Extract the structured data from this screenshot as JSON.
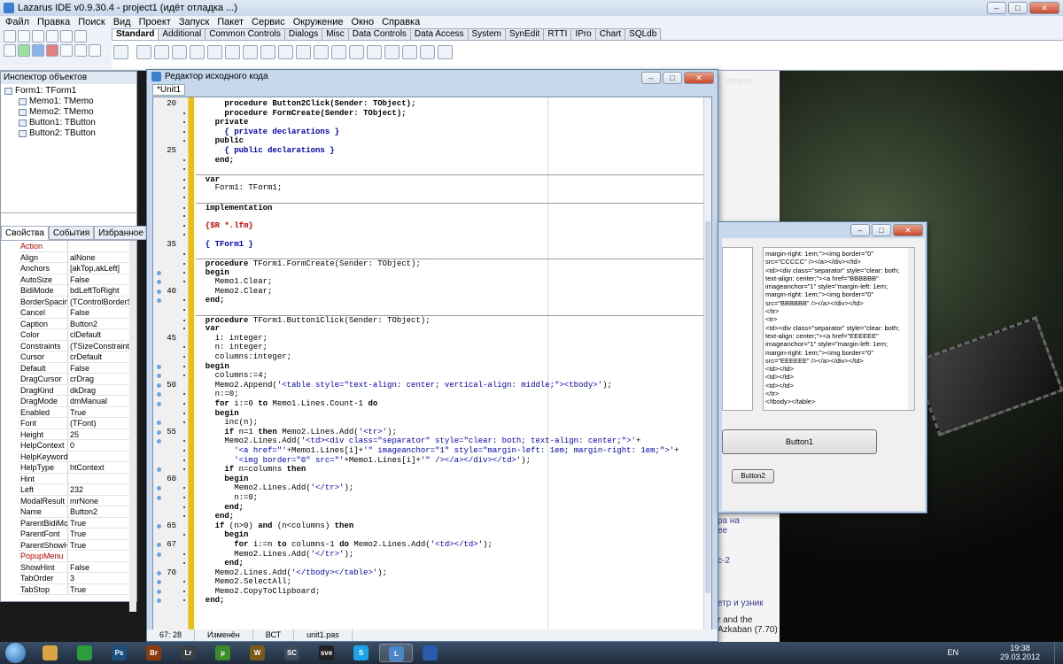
{
  "ide": {
    "title": "Lazarus IDE v0.9.30.4 - project1 (идёт отладка ...)",
    "menu": [
      "Файл",
      "Правка",
      "Поиск",
      "Вид",
      "Проект",
      "Запуск",
      "Пакет",
      "Сервис",
      "Окружение",
      "Окно",
      "Справка"
    ],
    "palette_tabs": [
      "Standard",
      "Additional",
      "Common Controls",
      "Dialogs",
      "Misc",
      "Data Controls",
      "Data Access",
      "System",
      "SynEdit",
      "RTTI",
      "IPro",
      "Chart",
      "SQLdb"
    ],
    "active_palette_tab": "Standard"
  },
  "inspector": {
    "title": "Инспектор объектов",
    "tree": [
      {
        "label": "Form1: TForm1",
        "child": false
      },
      {
        "label": "Memo1: TMemo",
        "child": true
      },
      {
        "label": "Memo2: TMemo",
        "child": true
      },
      {
        "label": "Button1: TButton",
        "child": true
      },
      {
        "label": "Button2: TButton",
        "child": true
      }
    ],
    "tabs": [
      "Свойства",
      "События",
      "Избранное"
    ],
    "props": [
      {
        "n": "Action",
        "v": "",
        "section": true
      },
      {
        "n": "Align",
        "v": "alNone"
      },
      {
        "n": "Anchors",
        "v": "[akTop,akLeft]"
      },
      {
        "n": "AutoSize",
        "v": "False"
      },
      {
        "n": "BidiMode",
        "v": "bdLeftToRight"
      },
      {
        "n": "BorderSpacing",
        "v": "(TControlBorderS"
      },
      {
        "n": "Cancel",
        "v": "False"
      },
      {
        "n": "Caption",
        "v": "Button2"
      },
      {
        "n": "Color",
        "v": "clDefault"
      },
      {
        "n": "Constraints",
        "v": "(TSizeConstraints"
      },
      {
        "n": "Cursor",
        "v": "crDefault"
      },
      {
        "n": "Default",
        "v": "False"
      },
      {
        "n": "DragCursor",
        "v": "crDrag"
      },
      {
        "n": "DragKind",
        "v": "dkDrag"
      },
      {
        "n": "DragMode",
        "v": "dmManual"
      },
      {
        "n": "Enabled",
        "v": "True"
      },
      {
        "n": "Font",
        "v": "(TFont)"
      },
      {
        "n": "Height",
        "v": "25"
      },
      {
        "n": "HelpContext",
        "v": "0"
      },
      {
        "n": "HelpKeyword",
        "v": ""
      },
      {
        "n": "HelpType",
        "v": "htContext"
      },
      {
        "n": "Hint",
        "v": ""
      },
      {
        "n": "Left",
        "v": "232"
      },
      {
        "n": "ModalResult",
        "v": "mrNone"
      },
      {
        "n": "Name",
        "v": "Button2"
      },
      {
        "n": "ParentBidiMode",
        "v": "True"
      },
      {
        "n": "ParentFont",
        "v": "True"
      },
      {
        "n": "ParentShowHint",
        "v": "True"
      },
      {
        "n": "PopupMenu",
        "v": "",
        "section": true
      },
      {
        "n": "ShowHint",
        "v": "False"
      },
      {
        "n": "TabOrder",
        "v": "3"
      },
      {
        "n": "TabStop",
        "v": "True"
      }
    ]
  },
  "editor": {
    "title": "Редактор исходного кода",
    "tab": "*Unit1",
    "status": [
      "67: 28",
      "Изменён",
      "ВСТ",
      "unit1.pas"
    ],
    "lines": [
      {
        "ln": "20",
        "segs": [
          [
            "      procedure Button2Click(Sender: TObject);",
            "kw"
          ]
        ]
      },
      {
        "segs": [
          [
            "      procedure FormCreate(Sender: TObject);",
            "kw"
          ]
        ]
      },
      {
        "segs": [
          [
            "    private",
            "kw"
          ]
        ]
      },
      {
        "segs": [
          [
            "      { private declarations }",
            "cm"
          ]
        ]
      },
      {
        "segs": [
          [
            "    public",
            "kw"
          ]
        ]
      },
      {
        "ln": "25",
        "segs": [
          [
            "      { public declarations }",
            "cm"
          ]
        ]
      },
      {
        "segs": [
          [
            "    end;",
            "kw"
          ]
        ]
      },
      {
        "segs": [
          [
            "",
            ""
          ]
        ]
      },
      {
        "segs": [
          [
            "  var",
            "kw"
          ]
        ],
        "sep": true
      },
      {
        "segs": [
          [
            "    Form1: TForm1;",
            ""
          ]
        ]
      },
      {
        "segs": [
          [
            "",
            ""
          ]
        ]
      },
      {
        "segs": [
          [
            "  implementation",
            "kw"
          ]
        ],
        "sep": true
      },
      {
        "segs": [
          [
            "",
            ""
          ]
        ]
      },
      {
        "segs": [
          [
            "  {$R *.lfm}",
            "dir"
          ]
        ]
      },
      {
        "segs": [
          [
            "",
            ""
          ]
        ]
      },
      {
        "ln": "35",
        "segs": [
          [
            "  { TForm1 }",
            "cm"
          ]
        ]
      },
      {
        "segs": [
          [
            "",
            ""
          ]
        ]
      },
      {
        "segs": [
          [
            "  procedure",
            "kw"
          ],
          [
            " TForm1.FormCreate(Sender: TObject);",
            ""
          ]
        ],
        "sep": true
      },
      {
        "bp": true,
        "segs": [
          [
            "  begin",
            "kw"
          ]
        ]
      },
      {
        "bp": true,
        "segs": [
          [
            "    Memo1.Clear;",
            ""
          ]
        ]
      },
      {
        "ln": "40",
        "bp": true,
        "segs": [
          [
            "    Memo2.Clear;",
            ""
          ]
        ]
      },
      {
        "bp": true,
        "segs": [
          [
            "  end;",
            "kw"
          ]
        ]
      },
      {
        "segs": [
          [
            "",
            ""
          ]
        ]
      },
      {
        "segs": [
          [
            "  procedure",
            "kw"
          ],
          [
            " TForm1.Button1Click(Sender: TObject);",
            ""
          ]
        ],
        "sep": true
      },
      {
        "segs": [
          [
            "  var",
            "kw"
          ]
        ]
      },
      {
        "ln": "45",
        "segs": [
          [
            "    i: integer;",
            ""
          ]
        ]
      },
      {
        "segs": [
          [
            "    n: integer;",
            ""
          ]
        ]
      },
      {
        "segs": [
          [
            "    columns:integer;",
            ""
          ]
        ]
      },
      {
        "bp": true,
        "segs": [
          [
            "  begin",
            "kw"
          ]
        ]
      },
      {
        "bp": true,
        "segs": [
          [
            "    columns:=4;",
            ""
          ]
        ]
      },
      {
        "ln": "50",
        "bp": true,
        "segs": [
          [
            "    Memo2.Append(",
            ""
          ],
          [
            "'<table style=\"text-align: center; vertical-align: middle;\"><tbody>'",
            "str"
          ],
          [
            ");",
            ""
          ]
        ]
      },
      {
        "bp": true,
        "segs": [
          [
            "    n:=0;",
            ""
          ]
        ]
      },
      {
        "bp": true,
        "segs": [
          [
            "    for",
            "kw"
          ],
          [
            " i:=0 ",
            ""
          ],
          [
            "to",
            "kw"
          ],
          [
            " Memo1.Lines.Count-1 ",
            ""
          ],
          [
            "do",
            "kw"
          ]
        ]
      },
      {
        "segs": [
          [
            "    begin",
            "kw"
          ]
        ]
      },
      {
        "bp": true,
        "segs": [
          [
            "      inc(n);",
            ""
          ]
        ]
      },
      {
        "ln": "55",
        "bp": true,
        "segs": [
          [
            "      if",
            "kw"
          ],
          [
            " n=1 ",
            ""
          ],
          [
            "then",
            "kw"
          ],
          [
            " Memo2.Lines.Add(",
            ""
          ],
          [
            "'<tr>'",
            "str"
          ],
          [
            ");",
            ""
          ]
        ]
      },
      {
        "bp": true,
        "segs": [
          [
            "      Memo2.Lines.Add(",
            ""
          ],
          [
            "'<td><div class=\"separator\" style=\"clear: both; text-align: center;\">'",
            "str"
          ],
          [
            "+",
            ""
          ]
        ]
      },
      {
        "segs": [
          [
            "        ",
            ""
          ],
          [
            "'<a href=\"'",
            "str"
          ],
          [
            "+Memo1.Lines[i]+",
            ""
          ],
          [
            "'\" imageanchor=\"1\" style=\"margin-left: 1em; margin-right: 1em;\">'",
            "str"
          ],
          [
            "+",
            ""
          ]
        ]
      },
      {
        "segs": [
          [
            "        ",
            ""
          ],
          [
            "'<img border=\"0\" src=\"'",
            "str"
          ],
          [
            "+Memo1.Lines[i]+",
            ""
          ],
          [
            "'\" /></a></div></td>'",
            "str"
          ],
          [
            ");",
            ""
          ]
        ]
      },
      {
        "bp": true,
        "segs": [
          [
            "      if",
            "kw"
          ],
          [
            " n=columns ",
            ""
          ],
          [
            "then",
            "kw"
          ]
        ]
      },
      {
        "ln": "60",
        "segs": [
          [
            "      begin",
            "kw"
          ]
        ]
      },
      {
        "bp": true,
        "segs": [
          [
            "        Memo2.Lines.Add(",
            ""
          ],
          [
            "'</tr>'",
            "str"
          ],
          [
            ");",
            ""
          ]
        ]
      },
      {
        "bp": true,
        "segs": [
          [
            "        n:=0;",
            ""
          ]
        ]
      },
      {
        "segs": [
          [
            "      end;",
            "kw"
          ]
        ]
      },
      {
        "segs": [
          [
            "    end;",
            "kw"
          ]
        ]
      },
      {
        "ln": "65",
        "bp": true,
        "segs": [
          [
            "    if",
            "kw"
          ],
          [
            " (n>0) ",
            ""
          ],
          [
            "and",
            "kw"
          ],
          [
            " (n<columns) ",
            ""
          ],
          [
            "then",
            "kw"
          ]
        ]
      },
      {
        "segs": [
          [
            "      begin",
            "kw"
          ]
        ]
      },
      {
        "ln": "67",
        "bp": true,
        "segs": [
          [
            "        for",
            "kw"
          ],
          [
            " i:=n ",
            ""
          ],
          [
            "to",
            "kw"
          ],
          [
            " columns-1 ",
            ""
          ],
          [
            "do",
            "kw"
          ],
          [
            " Memo2.Lines.Add(",
            ""
          ],
          [
            "'<td></td>'",
            "str"
          ],
          [
            ");",
            ""
          ]
        ]
      },
      {
        "bp": true,
        "segs": [
          [
            "        Memo2.Lines.Add(",
            ""
          ],
          [
            "'</tr>'",
            "str"
          ],
          [
            ");",
            ""
          ]
        ]
      },
      {
        "segs": [
          [
            "      end;",
            "kw"
          ]
        ]
      },
      {
        "ln": "70",
        "bp": true,
        "segs": [
          [
            "    Memo2.Lines.Add(",
            ""
          ],
          [
            "'</tbody></table>'",
            "str"
          ],
          [
            ");",
            ""
          ]
        ]
      },
      {
        "bp": true,
        "segs": [
          [
            "    Memo2.SelectAll;",
            ""
          ]
        ]
      },
      {
        "bp": true,
        "segs": [
          [
            "    Memo2.CopyToClipboard;",
            ""
          ]
        ]
      },
      {
        "bp": true,
        "segs": [
          [
            "  end;",
            "kw"
          ]
        ]
      }
    ]
  },
  "form": {
    "memo2_lines": [
      "margin-right: 1em;\"><img border=\"0\"",
      "src=\"CCCCC\" /></a></div></td>",
      "<td><div class=\"separator\" style=\"clear: both;",
      "text-align: center;\"><a href=\"BBBBBB\"",
      "imageanchor=\"1\" style=\"margin-left: 1em;",
      "margin-right: 1em;\"><img border=\"0\"",
      "src=\"BBBBBB\" /></a></div></td>",
      "</tr>",
      "<tr>",
      "<td><div class=\"separator\" style=\"clear: both;",
      "text-align: center;\"><a href=\"EEEEEE\"",
      "imageanchor=\"1\" style=\"margin-left: 1em;",
      "margin-right: 1em;\"><img border=\"0\"",
      "src=\"EEEEEE\" /></a></div></td>",
      "<td></td>",
      "<td></td>",
      "<td></td>",
      "</tr>",
      "</tbody></table>"
    ],
    "button1": "Button1",
    "button2": "Button2"
  },
  "desktop": {
    "texts": [
      "атров",
      "ра на",
      "ее",
      "c-2",
      "етр и узник",
      "r and the",
      "Azkaban (7.70)"
    ]
  },
  "taskbar": {
    "apps": [
      {
        "name": "explorer-icon",
        "label": "",
        "color": "#d9a441"
      },
      {
        "name": "chrome-icon",
        "label": "",
        "color": "#2c9c3c"
      },
      {
        "name": "photoshop-icon",
        "label": "Ps",
        "color": "#1b4f7e"
      },
      {
        "name": "bridge-icon",
        "label": "Br",
        "color": "#8b3a10"
      },
      {
        "name": "lightroom-icon",
        "label": "Lr",
        "color": "#3a3f46"
      },
      {
        "name": "utorrent-icon",
        "label": "µ",
        "color": "#3d8b2b"
      },
      {
        "name": "wow-icon",
        "label": "W",
        "color": "#7a5b1a"
      },
      {
        "name": "starcraft-icon",
        "label": "SC",
        "color": "#3f4a5a"
      },
      {
        "name": "sve-icon",
        "label": "sve",
        "color": "#222"
      },
      {
        "name": "skype-icon",
        "label": "S",
        "color": "#1aa3e8"
      },
      {
        "name": "lazarus-icon",
        "label": "L",
        "color": "#4a86c8"
      },
      {
        "name": "paw-icon",
        "label": "",
        "color": "#2a5aa8"
      }
    ],
    "lang": "EN",
    "time": "19:38",
    "date": "29.03.2012"
  }
}
